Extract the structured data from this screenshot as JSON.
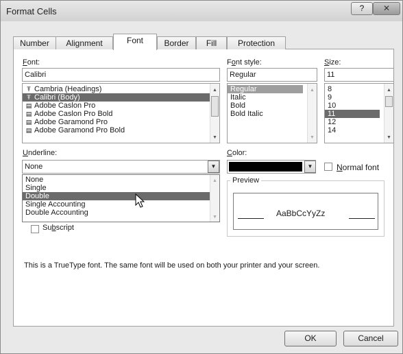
{
  "window": {
    "title": "Format Cells",
    "help_label": "?",
    "close_label": "✕"
  },
  "tabs": [
    {
      "label": "Number"
    },
    {
      "label": "Alignment"
    },
    {
      "label": "Font"
    },
    {
      "label": "Border"
    },
    {
      "label": "Fill"
    },
    {
      "label": "Protection"
    }
  ],
  "active_tab": "Font",
  "font": {
    "label_key": "F",
    "label_rest": "ont:",
    "value": "Calibri",
    "items": [
      {
        "label": "Cambria (Headings)",
        "icon": "truetype-icon"
      },
      {
        "label": "Calibri (Body)",
        "icon": "truetype-icon"
      },
      {
        "label": "Adobe Caslon Pro",
        "icon": "opentype-icon"
      },
      {
        "label": "Adobe Caslon Pro Bold",
        "icon": "opentype-icon"
      },
      {
        "label": "Adobe Garamond Pro",
        "icon": "opentype-icon"
      },
      {
        "label": "Adobe Garamond Pro Bold",
        "icon": "opentype-icon"
      }
    ],
    "selected": "Calibri (Body)"
  },
  "font_style": {
    "label_pre": "F",
    "label_key": "o",
    "label_rest": "nt style:",
    "value": "Regular",
    "items": [
      {
        "label": "Regular"
      },
      {
        "label": "Italic"
      },
      {
        "label": "Bold"
      },
      {
        "label": "Bold Italic"
      }
    ],
    "selected": "Regular"
  },
  "size": {
    "label_key": "S",
    "label_rest": "ize:",
    "value": "11",
    "items": [
      {
        "label": "8"
      },
      {
        "label": "9"
      },
      {
        "label": "10"
      },
      {
        "label": "11"
      },
      {
        "label": "12"
      },
      {
        "label": "14"
      }
    ],
    "selected": "11"
  },
  "underline": {
    "label_key": "U",
    "label_rest": "nderline:",
    "value": "None",
    "options": [
      {
        "label": "None"
      },
      {
        "label": "Single"
      },
      {
        "label": "Double"
      },
      {
        "label": "Single Accounting"
      },
      {
        "label": "Double Accounting"
      }
    ],
    "hovered": "Double"
  },
  "color": {
    "label_key": "C",
    "label_rest": "olor:",
    "value_hex": "#000000"
  },
  "normal_font": {
    "label_key": "N",
    "label_rest": "ormal font",
    "checked": false
  },
  "subscript": {
    "label_pre": "Su",
    "label_key": "b",
    "label_rest": "script",
    "checked": false
  },
  "preview": {
    "title": "Preview",
    "sample": "AaBbCcYyZz"
  },
  "info_text": "This is a TrueType font.  The same font will be used on both your printer and your screen.",
  "buttons": {
    "ok": "OK",
    "cancel": "Cancel"
  }
}
